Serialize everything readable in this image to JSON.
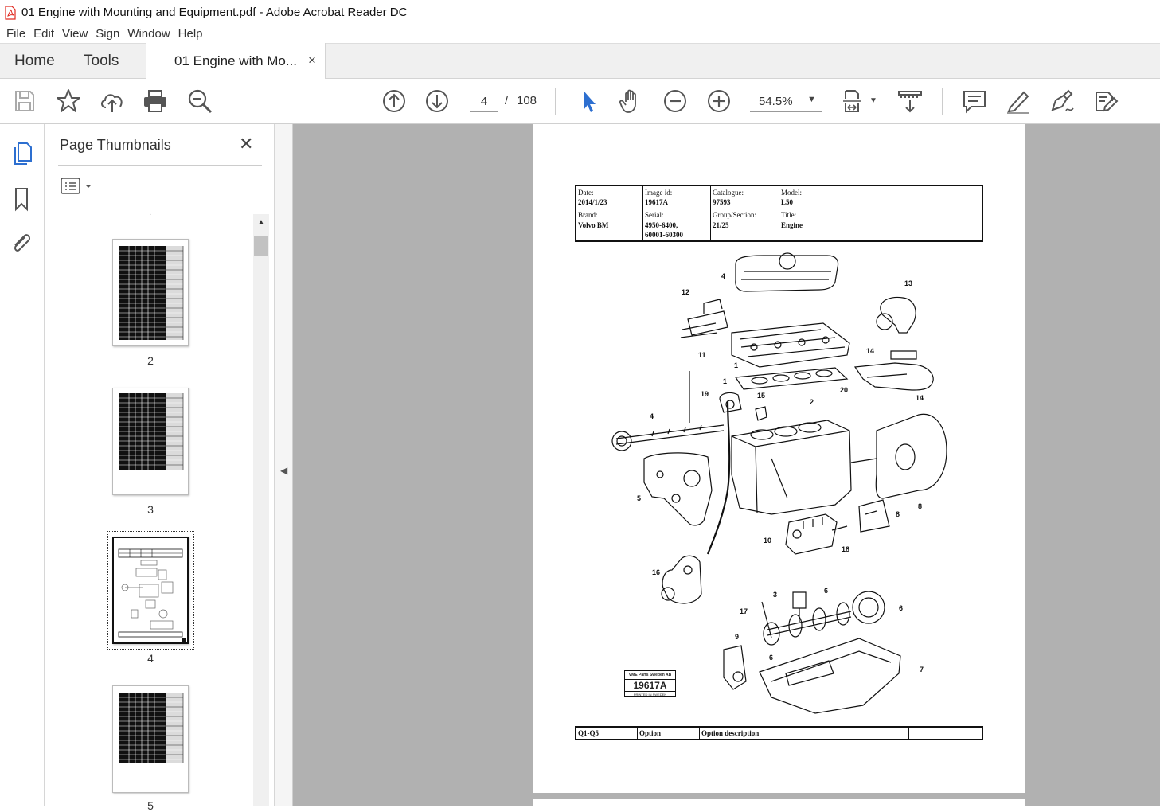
{
  "window": {
    "title": "01 Engine with Mounting and Equipment.pdf - Adobe Acrobat Reader DC"
  },
  "menu": [
    "File",
    "Edit",
    "View",
    "Sign",
    "Window",
    "Help"
  ],
  "tabs": {
    "home": "Home",
    "tools": "Tools",
    "document": "01 Engine with Mo...",
    "close": "×"
  },
  "toolbar": {
    "page_current": "4",
    "page_sep": "/",
    "page_total": "108",
    "zoom": "54.5%"
  },
  "thumbnails": {
    "heading": "Page Thumbnails",
    "close": "✕",
    "pages": [
      "2",
      "3",
      "4",
      "5"
    ],
    "selected": "4"
  },
  "document": {
    "header": {
      "date_label": "Date:",
      "date": "2014/1/23",
      "image_id_label": "Image id:",
      "image_id": "19617A",
      "catalogue_label": "Catalogue:",
      "catalogue": "97593",
      "model_label": "Model:",
      "model": "L50",
      "brand_label": "Brand:",
      "brand": "Volvo BM",
      "serial_label": "Serial:",
      "serial_1": "4950-6400,",
      "serial_2": "60001-60300",
      "group_label": "Group/Section:",
      "group": "21/25",
      "title_label": "Title:",
      "title": "Engine"
    },
    "footer": {
      "col1": "Q1-Q5",
      "col2": "Option",
      "col3": "Option description",
      "col4": ""
    },
    "stamp": {
      "line1": "VME Parts Sweden AB",
      "code": "19617A",
      "line3": "PRINTED IN SWEDEN"
    },
    "callouts": [
      "4",
      "12",
      "13",
      "11",
      "1",
      "14",
      "1",
      "19",
      "15",
      "2",
      "20",
      "14",
      "4",
      "5",
      "8",
      "8",
      "10",
      "18",
      "16",
      "3",
      "6",
      "6",
      "17",
      "9",
      "6",
      "7"
    ]
  },
  "colors": {
    "accent": "#2d6fd0",
    "pdf_red": "#e02a20",
    "doc_bg": "#b1b1b1"
  }
}
